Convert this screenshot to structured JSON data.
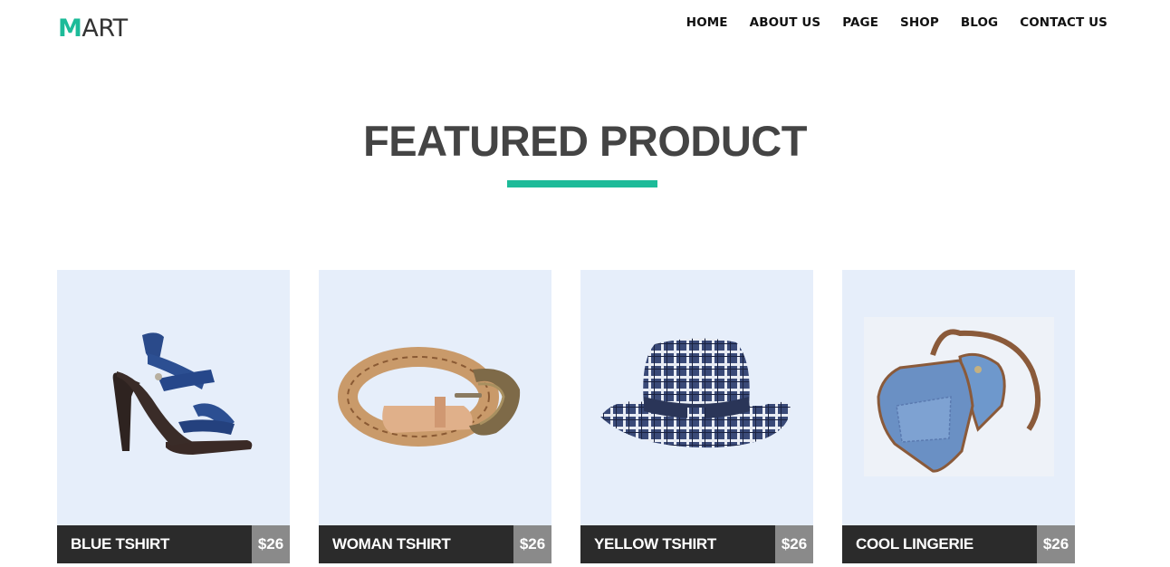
{
  "header": {
    "logo_first": "M",
    "logo_rest": "ART",
    "nav": [
      "HOME",
      "ABOUT US",
      "PAGE",
      "SHOP",
      "BLOG",
      "CONTACT US"
    ]
  },
  "section": {
    "title": "FEATURED PRODUCT"
  },
  "products": [
    {
      "name": "BLUE TSHIRT",
      "price": "$26",
      "image": "high-heel-sandal-image"
    },
    {
      "name": "WOMAN TSHIRT",
      "price": "$26",
      "image": "braided-belt-image"
    },
    {
      "name": "YELLOW TSHIRT",
      "price": "$26",
      "image": "plaid-fedora-hat-image"
    },
    {
      "name": "COOL LINGERIE",
      "price": "$26",
      "image": "denim-shoulder-bag-image"
    }
  ],
  "colors": {
    "accent": "#1dbb99",
    "card_bg": "#e6eefa",
    "label_bg": "#2b2b2b",
    "price_bg": "#8a8a8a",
    "title": "#444444"
  }
}
